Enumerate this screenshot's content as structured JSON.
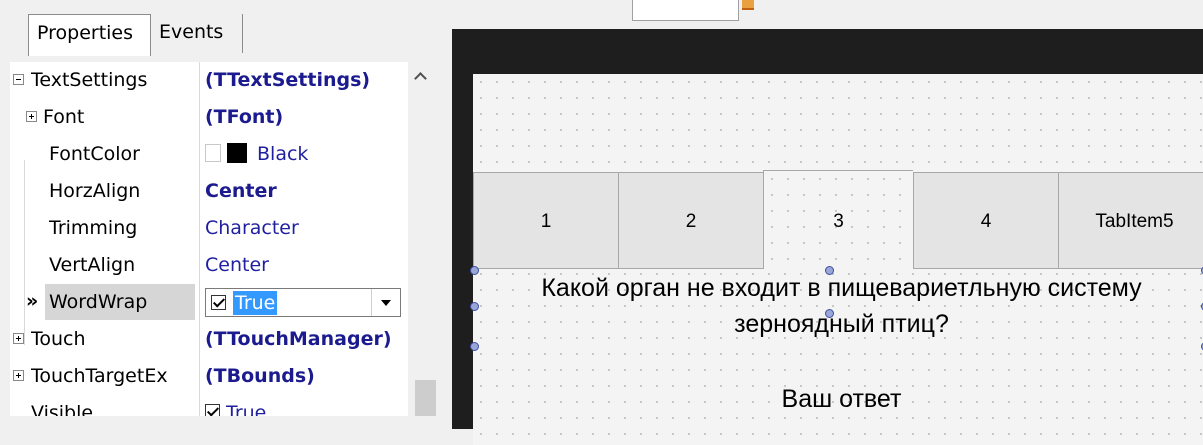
{
  "inspector": {
    "tabs": [
      {
        "label": "Properties"
      },
      {
        "label": "Events"
      }
    ],
    "rows": [
      {
        "name": "TextSettings",
        "value": "(TTextSettings)"
      },
      {
        "name": "Font",
        "value": "(TFont)"
      },
      {
        "name": "FontColor",
        "value": "Black"
      },
      {
        "name": "HorzAlign",
        "value": "Center"
      },
      {
        "name": "Trimming",
        "value": "Character"
      },
      {
        "name": "VertAlign",
        "value": "Center"
      },
      {
        "name": "WordWrap",
        "value": "True"
      },
      {
        "name": "Touch",
        "value": "(TTouchManager)"
      },
      {
        "name": "TouchTargetEx",
        "value": "(TBounds)"
      },
      {
        "name": "Visible",
        "value": "True"
      }
    ],
    "row_marker": "»",
    "colors": {
      "font_color_swatch": "#000000",
      "selection": "#3399ff",
      "bold_value": "#1b1b8f"
    }
  },
  "designer": {
    "tabs": [
      {
        "label": "1"
      },
      {
        "label": "2"
      },
      {
        "label": "3"
      },
      {
        "label": "4"
      },
      {
        "label": "TabItem5"
      }
    ],
    "active_tab": "3",
    "question_lines": [
      "Какой орган не входит в пищевариетльную систему",
      "зерноядный птиц?"
    ],
    "answer": "Ваш ответ"
  }
}
